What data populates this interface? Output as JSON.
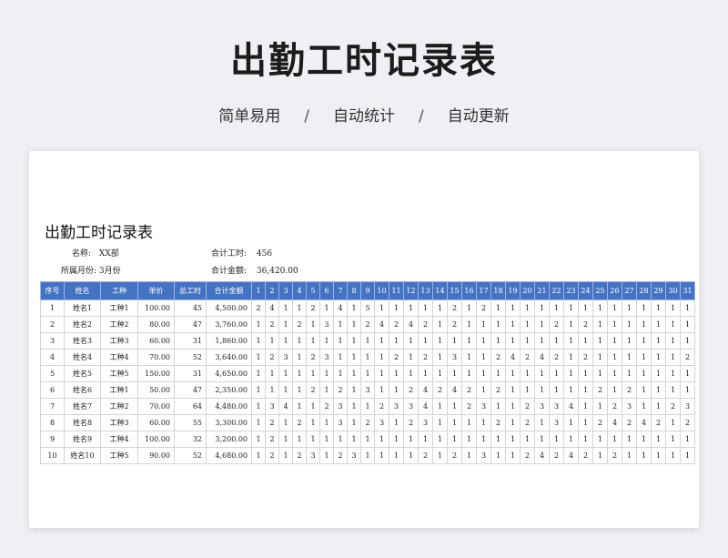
{
  "hero": {
    "title": "出勤工时记录表",
    "tags": [
      "简单易用",
      "自动统计",
      "自动更新"
    ],
    "separator": "/"
  },
  "sheet": {
    "title": "出勤工时记录表",
    "meta": {
      "name_label": "名称:",
      "name_value": "XX部",
      "month_label": "所属月份:",
      "month_value": "3月份",
      "total_hours_label": "合计工时:",
      "total_hours_value": "456",
      "total_amount_label": "合计金额:",
      "total_amount_value": "36,420.00"
    },
    "colors": {
      "header_bg": "#4472c4",
      "header_text": "#ffffff"
    },
    "headers": [
      "序号",
      "姓名",
      "工种",
      "单价",
      "总工时",
      "合计金额",
      "1",
      "2",
      "3",
      "4",
      "5",
      "6",
      "7",
      "8",
      "9",
      "10",
      "11",
      "12",
      "13",
      "14",
      "15",
      "16",
      "17",
      "18",
      "19",
      "20",
      "21",
      "22",
      "23",
      "24",
      "25",
      "26",
      "27",
      "28",
      "29",
      "30",
      "31"
    ],
    "rows": [
      {
        "no": "1",
        "name": "姓名1",
        "type": "工种1",
        "price": "100.00",
        "hours": "45",
        "amount": "4,500.00",
        "days": [
          "2",
          "4",
          "1",
          "1",
          "2",
          "1",
          "4",
          "1",
          "5",
          "1",
          "1",
          "1",
          "1",
          "1",
          "2",
          "1",
          "2",
          "1",
          "1",
          "1",
          "1",
          "1",
          "1",
          "1",
          "1",
          "1",
          "1",
          "1",
          "1",
          "1",
          "1"
        ]
      },
      {
        "no": "2",
        "name": "姓名2",
        "type": "工种2",
        "price": "80.00",
        "hours": "47",
        "amount": "3,760.00",
        "days": [
          "1",
          "2",
          "1",
          "2",
          "1",
          "3",
          "1",
          "1",
          "2",
          "4",
          "2",
          "4",
          "2",
          "1",
          "2",
          "1",
          "1",
          "1",
          "1",
          "1",
          "1",
          "2",
          "1",
          "2",
          "1",
          "1",
          "1",
          "1",
          "1",
          "1",
          "1"
        ]
      },
      {
        "no": "3",
        "name": "姓名3",
        "type": "工种3",
        "price": "60.00",
        "hours": "31",
        "amount": "1,860.00",
        "days": [
          "1",
          "1",
          "1",
          "1",
          "1",
          "1",
          "1",
          "1",
          "1",
          "1",
          "1",
          "1",
          "1",
          "1",
          "1",
          "1",
          "1",
          "1",
          "1",
          "1",
          "1",
          "1",
          "1",
          "1",
          "1",
          "1",
          "1",
          "1",
          "1",
          "1",
          "1"
        ]
      },
      {
        "no": "4",
        "name": "姓名4",
        "type": "工种4",
        "price": "70.00",
        "hours": "52",
        "amount": "3,640.00",
        "days": [
          "1",
          "2",
          "3",
          "1",
          "2",
          "3",
          "1",
          "1",
          "1",
          "1",
          "2",
          "1",
          "2",
          "1",
          "3",
          "1",
          "1",
          "2",
          "4",
          "2",
          "4",
          "2",
          "1",
          "2",
          "1",
          "1",
          "1",
          "1",
          "1",
          "1",
          "2"
        ]
      },
      {
        "no": "5",
        "name": "姓名5",
        "type": "工种5",
        "price": "150.00",
        "hours": "31",
        "amount": "4,650.00",
        "days": [
          "1",
          "1",
          "1",
          "1",
          "1",
          "1",
          "1",
          "1",
          "1",
          "1",
          "1",
          "1",
          "1",
          "1",
          "1",
          "1",
          "1",
          "1",
          "1",
          "1",
          "1",
          "1",
          "1",
          "1",
          "1",
          "1",
          "1",
          "1",
          "1",
          "1",
          "1"
        ]
      },
      {
        "no": "6",
        "name": "姓名6",
        "type": "工种1",
        "price": "50.00",
        "hours": "47",
        "amount": "2,350.00",
        "days": [
          "1",
          "1",
          "1",
          "1",
          "2",
          "1",
          "2",
          "1",
          "3",
          "1",
          "1",
          "2",
          "4",
          "2",
          "4",
          "2",
          "1",
          "2",
          "1",
          "1",
          "1",
          "1",
          "1",
          "1",
          "2",
          "1",
          "2",
          "1",
          "1",
          "1",
          "1"
        ]
      },
      {
        "no": "7",
        "name": "姓名7",
        "type": "工种2",
        "price": "70.00",
        "hours": "64",
        "amount": "4,480.00",
        "days": [
          "1",
          "3",
          "4",
          "1",
          "1",
          "2",
          "3",
          "1",
          "1",
          "2",
          "3",
          "3",
          "4",
          "1",
          "1",
          "2",
          "3",
          "1",
          "1",
          "2",
          "3",
          "3",
          "4",
          "1",
          "1",
          "2",
          "3",
          "1",
          "1",
          "2",
          "3"
        ]
      },
      {
        "no": "8",
        "name": "姓名8",
        "type": "工种3",
        "price": "60.00",
        "hours": "55",
        "amount": "3,300.00",
        "days": [
          "1",
          "2",
          "1",
          "2",
          "1",
          "1",
          "3",
          "1",
          "2",
          "3",
          "1",
          "2",
          "3",
          "1",
          "1",
          "1",
          "1",
          "2",
          "1",
          "2",
          "1",
          "3",
          "1",
          "1",
          "2",
          "4",
          "2",
          "4",
          "2",
          "1",
          "2"
        ]
      },
      {
        "no": "9",
        "name": "姓名9",
        "type": "工种4",
        "price": "100.00",
        "hours": "32",
        "amount": "3,200.00",
        "days": [
          "1",
          "2",
          "1",
          "1",
          "1",
          "1",
          "1",
          "1",
          "1",
          "1",
          "1",
          "1",
          "1",
          "1",
          "1",
          "1",
          "1",
          "1",
          "1",
          "1",
          "1",
          "1",
          "1",
          "1",
          "1",
          "1",
          "1",
          "1",
          "1",
          "1",
          "1"
        ]
      },
      {
        "no": "10",
        "name": "姓名10",
        "type": "工种5",
        "price": "90.00",
        "hours": "52",
        "amount": "4,680.00",
        "days": [
          "1",
          "2",
          "1",
          "2",
          "3",
          "1",
          "2",
          "3",
          "1",
          "1",
          "1",
          "1",
          "2",
          "1",
          "2",
          "1",
          "3",
          "1",
          "1",
          "2",
          "4",
          "2",
          "4",
          "2",
          "1",
          "2",
          "1",
          "1",
          "1",
          "1",
          "1"
        ]
      }
    ]
  }
}
